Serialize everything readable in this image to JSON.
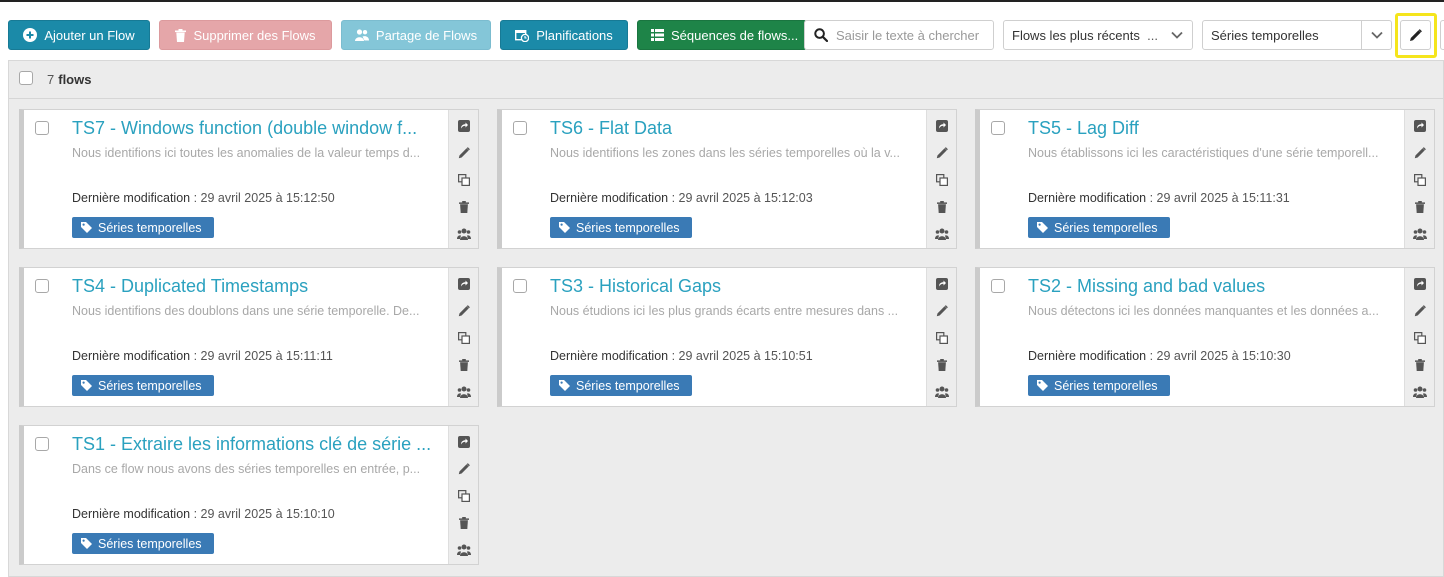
{
  "toolbar": {
    "add_flow_label": "Ajouter un Flow",
    "delete_flows_label": "Supprimer des Flows",
    "share_flows_label": "Partage de Flows",
    "schedules_label": "Planifications",
    "sequences_label": "Séquences de flows...",
    "search_placeholder": "Saisir le texte à chercher",
    "sort_value": "Flows les plus récents",
    "tag_filter_value": "Séries temporelles"
  },
  "list": {
    "count": "7",
    "count_label": "flows"
  },
  "flows": [
    {
      "title": "TS7 - Windows function (double window f...",
      "description": "Nous identifions ici toutes les anomalies de la valeur temps d...",
      "modified_label": "Dernière modification",
      "modified_value": ": 29 avril 2025 à 15:12:50",
      "tag": "Séries temporelles"
    },
    {
      "title": "TS6 - Flat Data",
      "description": "Nous identifions les zones dans les séries temporelles où la v...",
      "modified_label": "Dernière modification",
      "modified_value": ": 29 avril 2025 à 15:12:03",
      "tag": "Séries temporelles"
    },
    {
      "title": "TS5 - Lag Diff",
      "description": "Nous établissons ici les caractéristiques d'une série temporell...",
      "modified_label": "Dernière modification",
      "modified_value": ": 29 avril 2025 à 15:11:31",
      "tag": "Séries temporelles"
    },
    {
      "title": "TS4 - Duplicated Timestamps",
      "description": "Nous identifions des doublons dans une série temporelle. De...",
      "modified_label": "Dernière modification",
      "modified_value": ": 29 avril 2025 à 15:11:11",
      "tag": "Séries temporelles"
    },
    {
      "title": "TS3 - Historical Gaps",
      "description": "Nous étudions ici les plus grands écarts entre mesures dans ...",
      "modified_label": "Dernière modification",
      "modified_value": ": 29 avril 2025 à 15:10:51",
      "tag": "Séries temporelles"
    },
    {
      "title": "TS2 - Missing and bad values",
      "description": "Nous détectons ici les données manquantes et les données a...",
      "modified_label": "Dernière modification",
      "modified_value": ": 29 avril 2025 à 15:10:30",
      "tag": "Séries temporelles"
    },
    {
      "title": "TS1 - Extraire les informations clé de série ...",
      "description": "Dans ce flow nous avons des séries temporelles en entrée, p...",
      "modified_label": "Dernière modification",
      "modified_value": ": 29 avril 2025 à 15:10:10",
      "tag": "Séries temporelles"
    }
  ],
  "card_action_icons": [
    "open-flow-icon",
    "edit-icon",
    "duplicate-icon",
    "trash-icon",
    "users-icon"
  ],
  "colors": {
    "primary": "#1b8aa8",
    "danger_disabled": "#e5a6a9",
    "info_disabled": "#84c6d8",
    "success": "#1e8448",
    "title_link": "#2aa1bf",
    "tag": "#3a7ab5",
    "highlight": "#f5e51c"
  }
}
